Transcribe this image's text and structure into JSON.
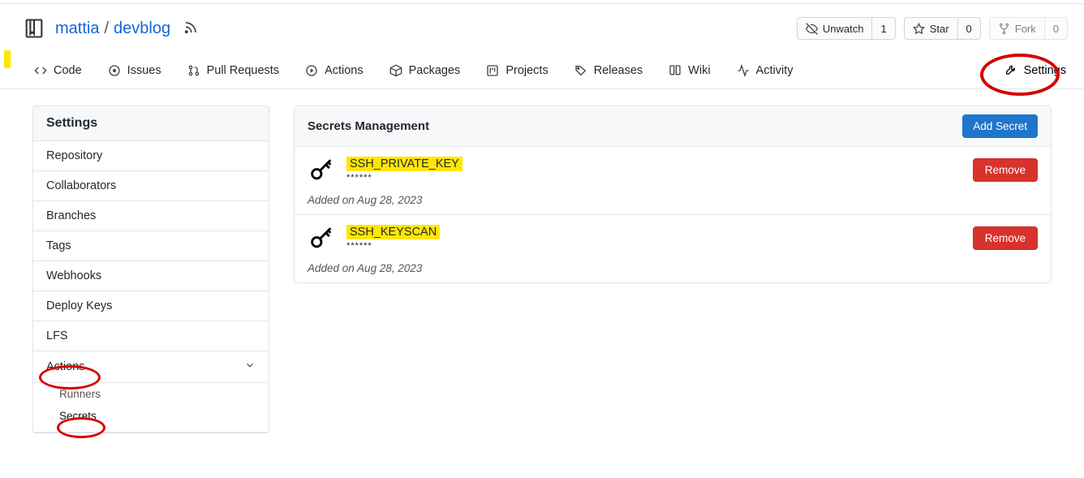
{
  "breadcrumb": {
    "owner": "mattia",
    "repo": "devblog"
  },
  "repoActions": {
    "unwatch": {
      "label": "Unwatch",
      "count": "1"
    },
    "star": {
      "label": "Star",
      "count": "0"
    },
    "fork": {
      "label": "Fork",
      "count": "0"
    }
  },
  "tabs": {
    "code": "Code",
    "issues": "Issues",
    "pulls": "Pull Requests",
    "actions": "Actions",
    "packages": "Packages",
    "projects": "Projects",
    "releases": "Releases",
    "wiki": "Wiki",
    "activity": "Activity",
    "settings": "Settings"
  },
  "sidebar": {
    "header": "Settings",
    "items": {
      "repository": "Repository",
      "collaborators": "Collaborators",
      "branches": "Branches",
      "tags": "Tags",
      "webhooks": "Webhooks",
      "deployKeys": "Deploy Keys",
      "lfs": "LFS",
      "actions": "Actions",
      "runners": "Runners",
      "secrets": "Secrets"
    }
  },
  "panel": {
    "title": "Secrets Management",
    "addButton": "Add Secret",
    "removeButton": "Remove",
    "mask": "******",
    "secrets": [
      {
        "name": "SSH_PRIVATE_KEY",
        "added": "Added on Aug 28, 2023"
      },
      {
        "name": "SSH_KEYSCAN",
        "added": "Added on Aug 28, 2023"
      }
    ]
  }
}
